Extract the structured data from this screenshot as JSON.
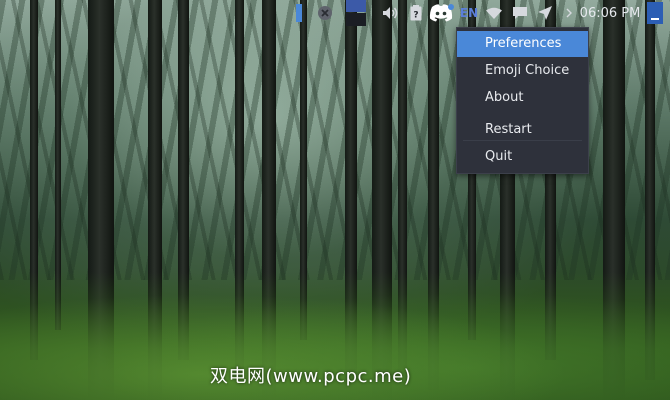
{
  "panel": {
    "language_indicator": "EN",
    "clock": "06:06 PM",
    "icons": [
      "activity-indicator-icon",
      "notification-close-icon",
      "window-preview-icon",
      "volume-icon",
      "clipboard-icon",
      "discord-icon",
      "wifi-icon",
      "chat-icon",
      "send-icon",
      "expand-arrow-icon",
      "panel-menu-icon"
    ],
    "accent_color": "#4a88d8"
  },
  "context_menu": {
    "items": [
      {
        "label": "Preferences",
        "highlighted": true
      },
      {
        "label": "Emoji Choice",
        "highlighted": false
      },
      {
        "label": "About",
        "highlighted": false
      },
      {
        "label": "Restart",
        "highlighted": false
      },
      {
        "label": "Quit",
        "highlighted": false
      }
    ]
  },
  "watermark": "双电网(www.pcpc.me)"
}
